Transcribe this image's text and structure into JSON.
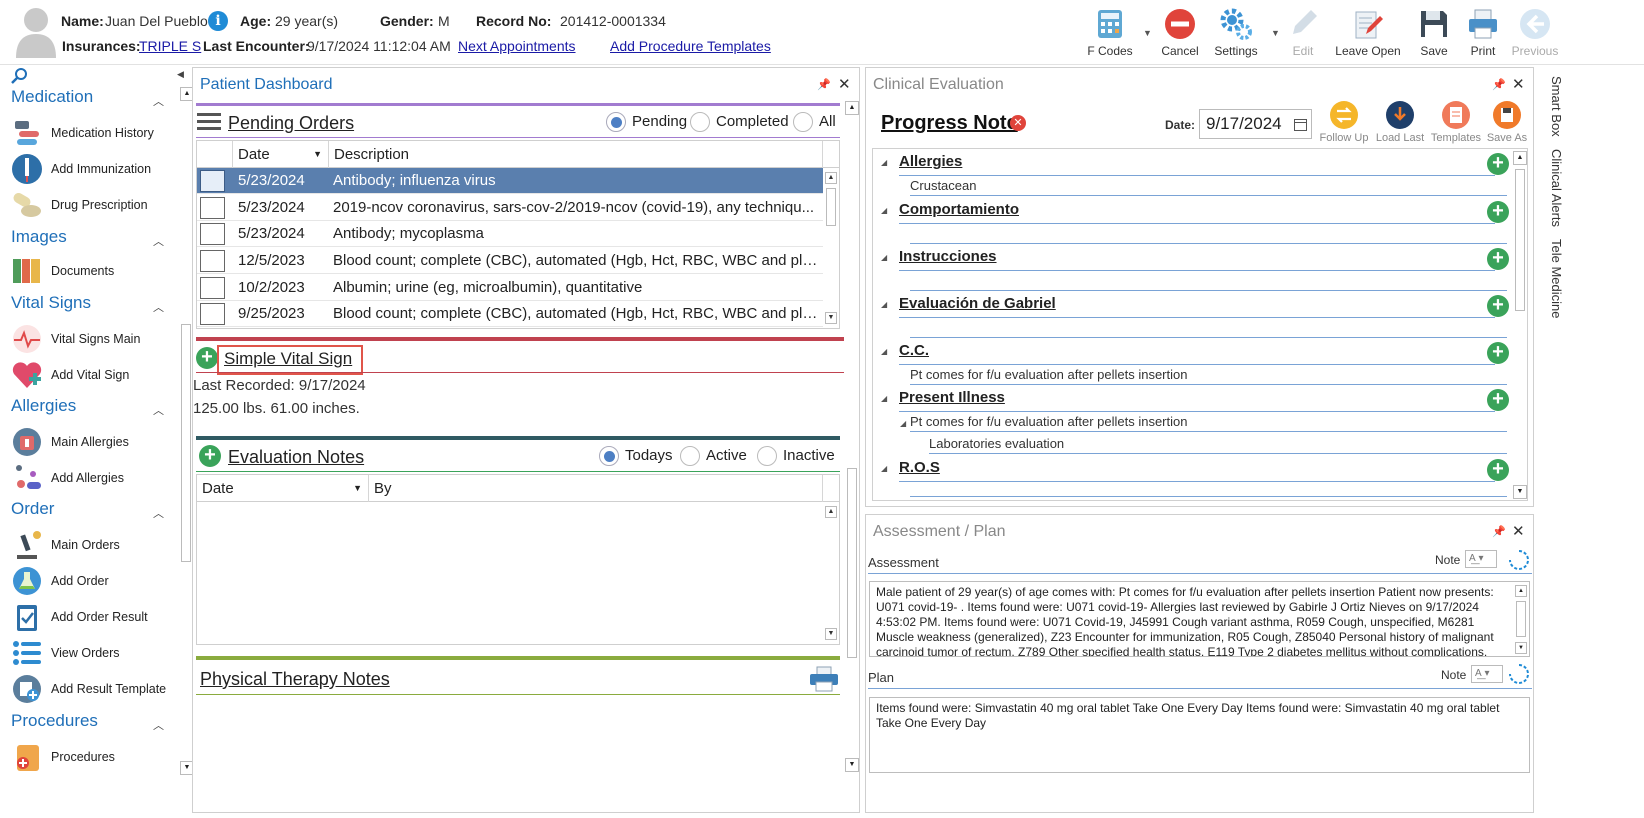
{
  "header": {
    "name_label": "Name:",
    "name": "Juan Del Pueblo",
    "age_label": "Age:",
    "age": "29 year(s)",
    "gender_label": "Gender:",
    "gender": "M",
    "record_label": "Record No:",
    "record": "201412-0001334",
    "insurances_label": "Insurances:",
    "insurance": "TRIPLE S",
    "last_encounter_label": "Last Encounter:",
    "last_encounter": "9/17/2024 11:12:04 AM",
    "next_appointments": "Next Appointments",
    "add_procedure_templates": "Add Procedure Templates"
  },
  "toolbar": {
    "fcodes": "F Codes",
    "cancel": "Cancel",
    "settings": "Settings",
    "edit": "Edit",
    "leave_open": "Leave Open",
    "save": "Save",
    "print": "Print",
    "previous": "Previous"
  },
  "leftnav": {
    "sections": [
      {
        "title": "Medication",
        "items": [
          "Medication History",
          "Add Immunization",
          "Drug Prescription"
        ]
      },
      {
        "title": "Images",
        "items": [
          "Documents"
        ]
      },
      {
        "title": "Vital Signs",
        "items": [
          "Vital Signs Main",
          "Add Vital Sign"
        ]
      },
      {
        "title": "Allergies",
        "items": [
          "Main Allergies",
          "Add Allergies"
        ]
      },
      {
        "title": "Order",
        "items": [
          "Main Orders",
          "Add Order",
          "Add Order Result",
          "View Orders",
          "Add Result Template"
        ]
      },
      {
        "title": "Procedures",
        "items": [
          "Procedures"
        ]
      }
    ]
  },
  "dashboard": {
    "title": "Patient Dashboard",
    "pending_orders": {
      "title": "Pending Orders",
      "filters": [
        "Pending",
        "Completed",
        "All"
      ],
      "columns": [
        "Date",
        "Description"
      ],
      "rows": [
        {
          "date": "5/23/2024",
          "desc": "Antibody; influenza virus"
        },
        {
          "date": "5/23/2024",
          "desc": "2019-ncov coronavirus, sars-cov-2/2019-ncov (covid-19), any techniqu..."
        },
        {
          "date": "5/23/2024",
          "desc": "Antibody; mycoplasma"
        },
        {
          "date": "12/5/2023",
          "desc": "Blood count; complete (CBC), automated (Hgb, Hct, RBC, WBC and pla..."
        },
        {
          "date": "10/2/2023",
          "desc": "Albumin; urine (eg, microalbumin), quantitative"
        },
        {
          "date": "9/25/2023",
          "desc": "Blood count; complete (CBC), automated (Hgb, Hct, RBC, WBC and pla..."
        }
      ]
    },
    "vital_sign": {
      "title": "Simple Vital Sign",
      "last_recorded": "Last Recorded: 9/17/2024",
      "values": "125.00 lbs. 61.00 inches."
    },
    "evaluation_notes": {
      "title": "Evaluation Notes",
      "filters": [
        "Todays",
        "Active",
        "Inactive"
      ],
      "columns": [
        "Date",
        "By"
      ]
    },
    "physical_therapy": {
      "title": "Physical Therapy Notes"
    }
  },
  "clinical": {
    "title": "Clinical Evaluation",
    "note_title": "Progress Note",
    "date_label": "Date:",
    "date": "9/17/2024",
    "tools": [
      "Follow Up",
      "Load Last",
      "Templates",
      "Save As"
    ],
    "sections": [
      {
        "title": "Allergies",
        "children": [
          "Crustacean"
        ]
      },
      {
        "title": "Comportamiento",
        "children": []
      },
      {
        "title": "Instrucciones",
        "children": []
      },
      {
        "title": "Evaluación de Gabriel",
        "children": []
      },
      {
        "title": "C.C.",
        "children": [
          "Pt comes for f/u evaluation after pellets insertion"
        ]
      },
      {
        "title": "Present Illness",
        "children": [
          "Pt comes for f/u evaluation after pellets insertion",
          "Laboratories evaluation"
        ]
      },
      {
        "title": "R.O.S",
        "children": []
      }
    ]
  },
  "assessment": {
    "title": "Assessment / Plan",
    "assessment_label": "Assessment",
    "plan_label": "Plan",
    "note_label": "Note",
    "assessment_text": "Male patient of 29 year(s) of age comes with:  Pt comes for f/u evaluation after pellets insertion  Patient now presents: U071 covid-19- . Items found were:  U071 covid-19-    Allergies last reviewed by Gabirle J Ortiz Nieves on 9/17/2024 4:53:02 PM.    Items found were:  U071 Covid-19, J45991 Cough variant asthma, R059 Cough, unspecified, M6281 Muscle weakness (generalized), Z23 Encounter for immunization, R05 Cough, Z85040 Personal history of malignant carcinoid tumor of rectum, Z789 Other specified health status, E119 Type 2 diabetes mellitus without complications,",
    "plan_text": "  Items found were:  Simvastatin 40 mg oral tablet Take One Every Day   Items found were:  Simvastatin 40 mg oral tablet Take One Every Day"
  },
  "side_tabs": [
    "Smart Box",
    "Clinical Alerts",
    "Tele Medicine"
  ],
  "colors": {
    "accent_blue": "#1f6fb8",
    "selected_row": "#5a7fae",
    "add_green": "#3aa35a",
    "highlight_red": "#e0554a"
  }
}
